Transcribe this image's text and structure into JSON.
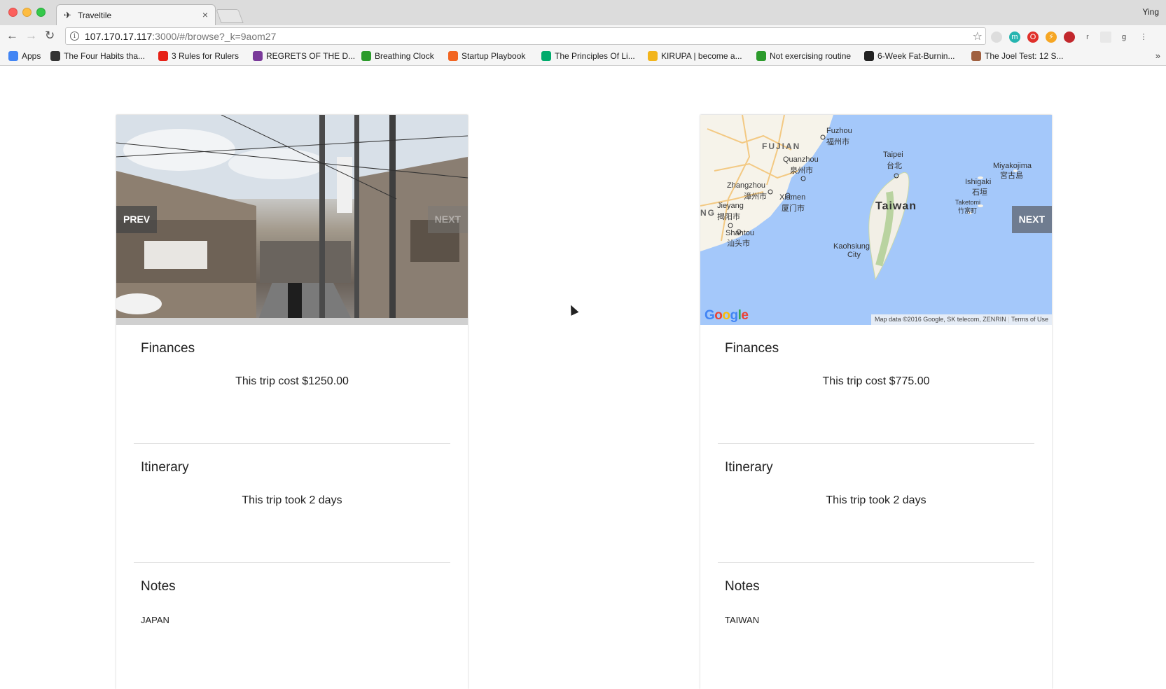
{
  "browser": {
    "tab_title": "Traveltile",
    "tab_close": "×",
    "profile_name": "Ying",
    "url_host": "107.170.17.117",
    "url_rest": ":3000/#/browse?_k=9aom27"
  },
  "bookmarks": [
    {
      "label": "Apps",
      "icon": "apps-grid-icon",
      "color": "#4285f4"
    },
    {
      "label": "The Four Habits tha...",
      "icon": "loop-icon",
      "color": "#333333"
    },
    {
      "label": "3 Rules for Rulers",
      "icon": "youtube-icon",
      "color": "#e62117"
    },
    {
      "label": "REGRETS OF THE D...",
      "icon": "bw-icon",
      "color": "#7a3a9a"
    },
    {
      "label": "Breathing Clock",
      "icon": "green-dot-icon",
      "color": "#2c9b2c"
    },
    {
      "label": "Startup Playbook",
      "icon": "y-combinator-icon",
      "color": "#f26522"
    },
    {
      "label": "The Principles Of Li...",
      "icon": "medium-icon",
      "color": "#00ab6c"
    },
    {
      "label": "KIRUPA | become a...",
      "icon": "kirupa-icon",
      "color": "#f2b51c"
    },
    {
      "label": "Not exercising routine",
      "icon": "green-dot-icon",
      "color": "#2c9b2c"
    },
    {
      "label": "6-Week Fat-Burnin...",
      "icon": "bf-icon",
      "color": "#222222"
    },
    {
      "label": "The Joel Test: 12 S...",
      "icon": "person-icon",
      "color": "#a06040"
    }
  ],
  "cards": [
    {
      "media_type": "photo",
      "prev_label": "PREV",
      "next_label": "NEXT",
      "finances_title": "Finances",
      "finances_text": "This trip cost $1250.00",
      "itinerary_title": "Itinerary",
      "itinerary_text": "This trip took 2 days",
      "notes_title": "Notes",
      "notes_text": "JAPAN"
    },
    {
      "media_type": "map",
      "next_label": "NEXT",
      "finances_title": "Finances",
      "finances_text": "This trip cost $775.00",
      "itinerary_title": "Itinerary",
      "itinerary_text": "This trip took 2 days",
      "notes_title": "Notes",
      "notes_text": "TAIWAN",
      "map": {
        "google_logo": "Google",
        "attribution": "Map data ©2016 Google, SK telecom, ZENRIN",
        "terms": "Terms of Use",
        "labels": {
          "fuzhou": "Fuzhou",
          "fuzhou_cn": "福州市",
          "fujian": "FUJIAN",
          "quanzhou": "Quanzhou",
          "quanzhou_cn": "泉州市",
          "taipei": "Taipei",
          "taipei_cn": "台北",
          "miyakojima": "Miyakojima",
          "miyakojima_cn": "宮古島",
          "zhangzhou": "Zhangzhou",
          "zhangzhou_cn": "漳州市",
          "xiamen": "Xiamen",
          "xiamen_cn": "厦门市",
          "ishigaki": "Ishigaki",
          "ishigaki_cn": "石垣",
          "taiwan": "Taiwan",
          "taketomi": "Taketomi",
          "taketomi_cn": "竹富町",
          "jieyang": "Jieyang",
          "jieyang_cn": "揭阳市",
          "ng": "NG",
          "shantou": "Shantou",
          "shantou_cn": "汕头市",
          "kaohsiung": "Kaohsiung",
          "city": "City"
        }
      }
    }
  ],
  "colors": {
    "next_button": "#6f7c90",
    "map_water": "#a4c8fa",
    "map_land": "#f6f3ea"
  }
}
